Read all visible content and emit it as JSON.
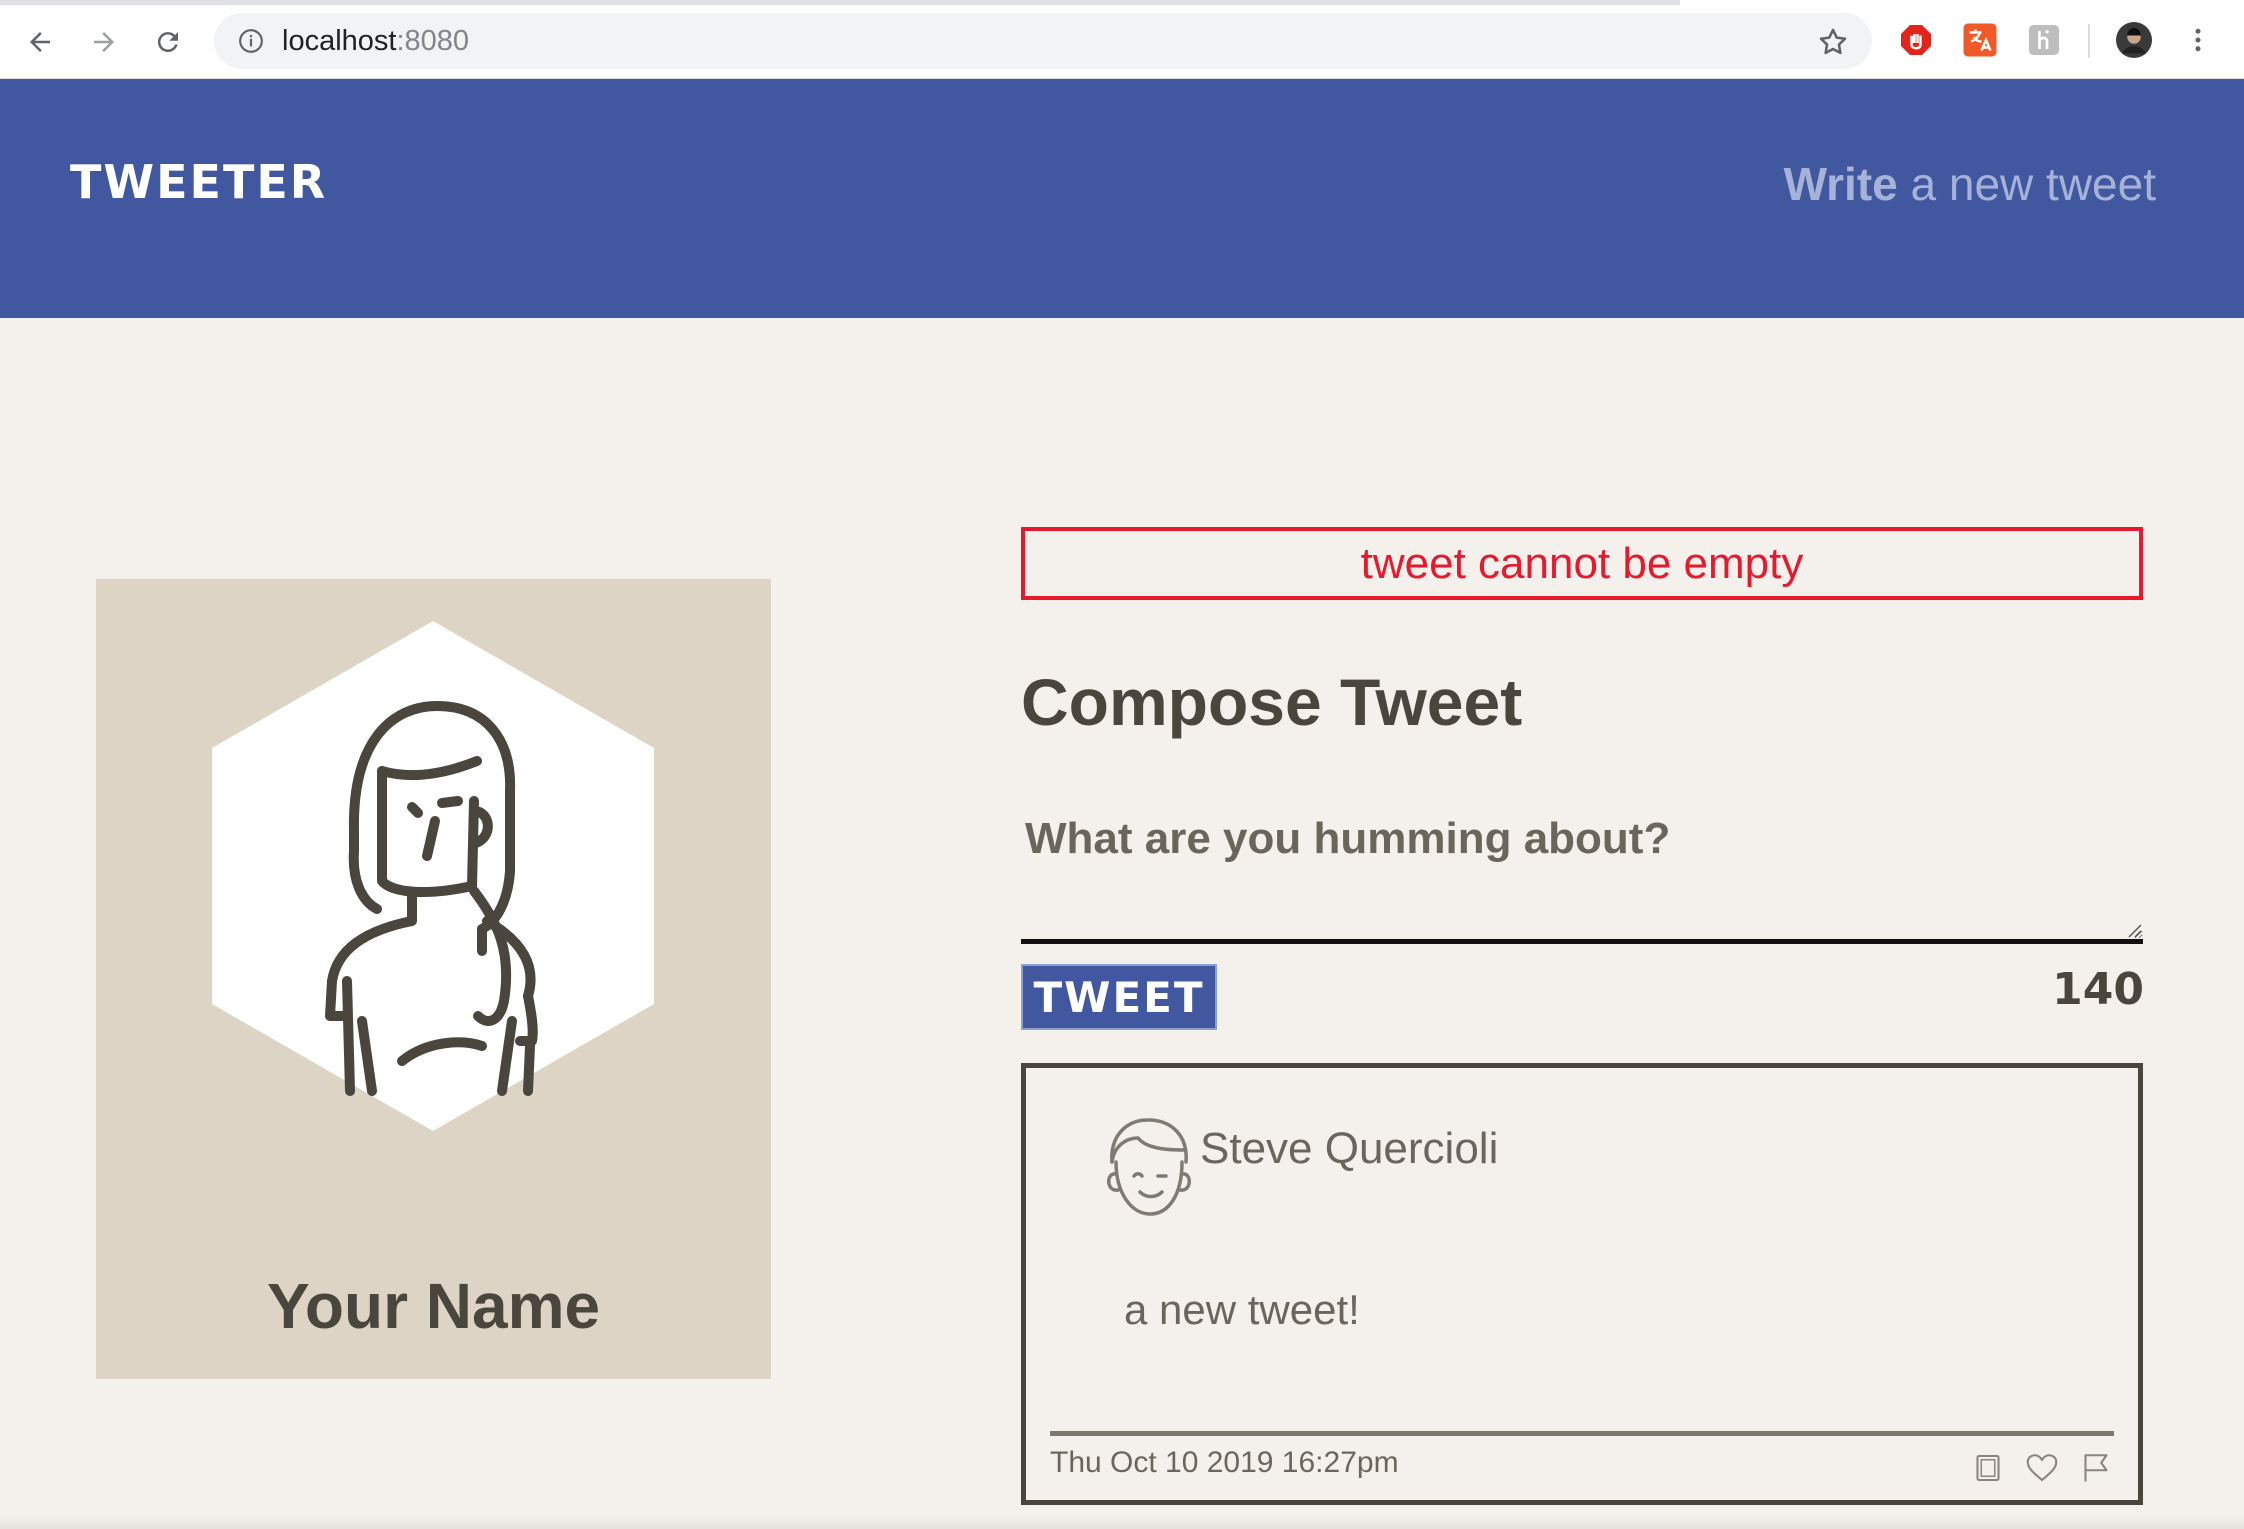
{
  "browser": {
    "url_host": "localhost",
    "url_port": ":8080",
    "icons": {
      "back": "arrow-left-icon",
      "forward": "arrow-right-icon",
      "reload": "reload-icon",
      "info": "info-icon",
      "bookmark": "star-icon",
      "extensions": [
        "adblock-icon",
        "translate-icon",
        "extension-icon"
      ],
      "profile": "avatar",
      "menu": "kebab-menu-icon"
    }
  },
  "header": {
    "brand": "TWEETER",
    "compose_bold": "Write",
    "compose_rest": " a new tweet",
    "colors": {
      "background": "#4158a0",
      "brand": "#ffffff",
      "link": "#a6b2d8"
    }
  },
  "profile": {
    "name": "Your Name",
    "colors": {
      "card": "#ddd4c5"
    }
  },
  "compose": {
    "error": "tweet cannot be empty",
    "title": "Compose Tweet",
    "placeholder": "What are you humming about?",
    "value": "",
    "button_label": "TWEET",
    "counter": "140",
    "colors": {
      "error": "#e8192c",
      "button": "#4158a0"
    }
  },
  "tweets": [
    {
      "author": "Steve Quercioli",
      "body": "a new tweet!",
      "timestamp": "Thu Oct 10 2019 16:27pm",
      "actions": [
        "retweet-icon",
        "heart-icon",
        "flag-icon"
      ]
    }
  ]
}
